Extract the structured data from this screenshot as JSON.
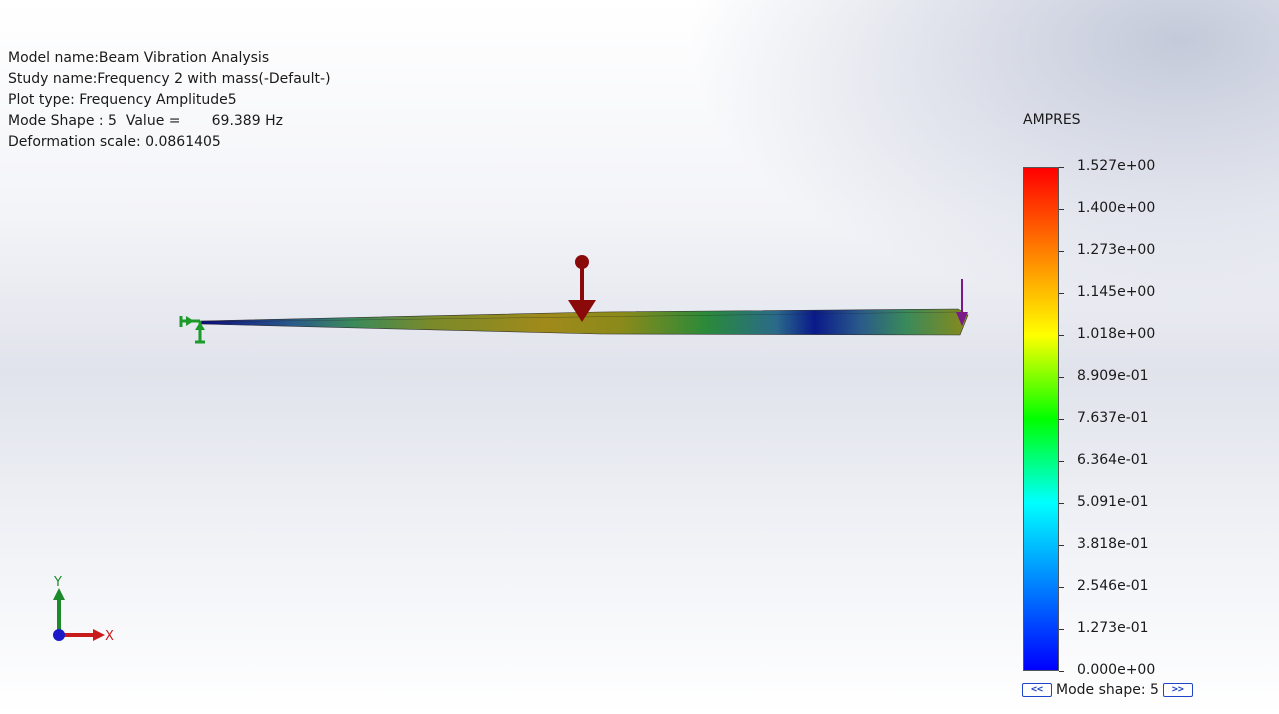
{
  "info": {
    "model_name": "Model name:Beam Vibration Analysis",
    "study_name": "Study name:Frequency 2 with mass(-Default-)",
    "plot_type": "Plot type: Frequency Amplitude5",
    "mode_shape": "Mode Shape : 5  Value =       69.389 Hz",
    "deformation_scale": "Deformation scale: 0.0861405"
  },
  "legend": {
    "title": "AMPRES",
    "ticks": [
      "1.527e+00",
      "1.400e+00",
      "1.273e+00",
      "1.145e+00",
      "1.018e+00",
      "8.909e-01",
      "7.637e-01",
      "6.364e-01",
      "5.091e-01",
      "3.818e-01",
      "2.546e-01",
      "1.273e-01",
      "0.000e+00"
    ],
    "colors": [
      "#ff0000",
      "#ff8000",
      "#ffff00",
      "#00ff00",
      "#00ffff",
      "#0080ff",
      "#0000ff"
    ]
  },
  "mode_nav": {
    "prev_label": "<<",
    "label": "Mode shape: 5",
    "next_label": ">>"
  },
  "triad": {
    "x_label": "X",
    "y_label": "Y"
  },
  "icons": {
    "fixture": "fixed-support-icon",
    "load": "force-arrow-icon",
    "mass": "remote-mass-icon",
    "triad": "coordinate-triad-icon"
  }
}
